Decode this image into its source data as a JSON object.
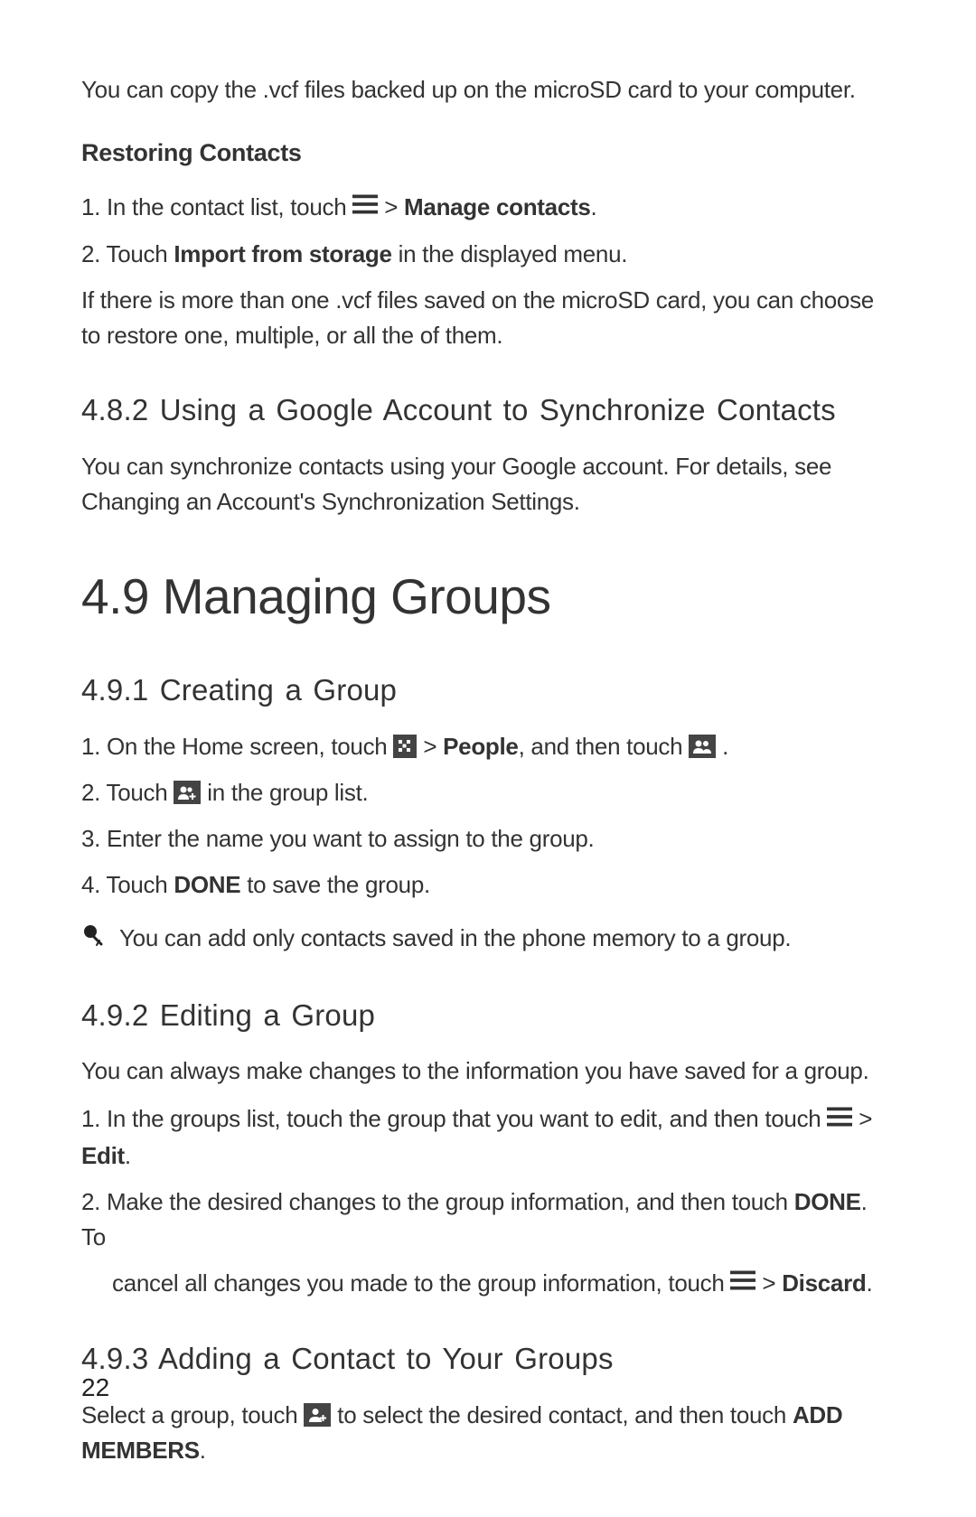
{
  "intro": "You can copy the .vcf files backed up on the microSD card to your computer.",
  "restoring": {
    "heading": "Restoring Contacts",
    "step1_a": "1. In the contact list, touch ",
    "step1_b": " > ",
    "step1_c": "Manage contacts",
    "step1_d": ".",
    "step2_a": "2. Touch ",
    "step2_b": "Import from storage",
    "step2_c": " in the displayed menu.",
    "note": "If there is more than one .vcf files saved on the microSD card, you can choose to restore one, multiple, or all the of them."
  },
  "s482": {
    "heading": "4.8.2  Using a Google Account to Synchronize Contacts",
    "body": "You can synchronize contacts using your Google account. For details, see Changing an Account's Synchronization Settings."
  },
  "s49": {
    "heading": "4.9  Managing Groups"
  },
  "s491": {
    "heading": "4.9.1  Creating a Group",
    "step1_a": "1. On the Home screen, touch ",
    "step1_b": " > ",
    "step1_c": "People",
    "step1_d": ", and then touch ",
    "step1_e": " .",
    "step2_a": "2. Touch ",
    "step2_b": " in the group list.",
    "step3": "3. Enter the name you want to assign to the group.",
    "step4_a": "4. Touch ",
    "step4_b": "DONE",
    "step4_c": " to save the group.",
    "note": "You can add only contacts saved in the phone memory to a group."
  },
  "s492": {
    "heading": "4.9.2  Editing a Group",
    "body": "You can always make changes to the information you have saved for a group.",
    "step1_a": "1. In the groups list, touch the group that you want to edit, and then touch ",
    "step1_b": " > ",
    "step1_c": "Edit",
    "step1_d": ".",
    "step2_a": "2. Make the desired changes to the group information, and then touch ",
    "step2_b": "DONE",
    "step2_c": ". To",
    "step2_cont_a": "cancel all changes you made to the group information, touch ",
    "step2_cont_b": " > ",
    "step2_cont_c": "Discard",
    "step2_cont_d": "."
  },
  "s493": {
    "heading": "4.9.3  Adding a Contact to Your Groups",
    "body_a": "Select a group, touch ",
    "body_b": " to select the desired contact, and then touch ",
    "body_c": "ADD MEMBERS",
    "body_d": "."
  },
  "page_number": "22"
}
